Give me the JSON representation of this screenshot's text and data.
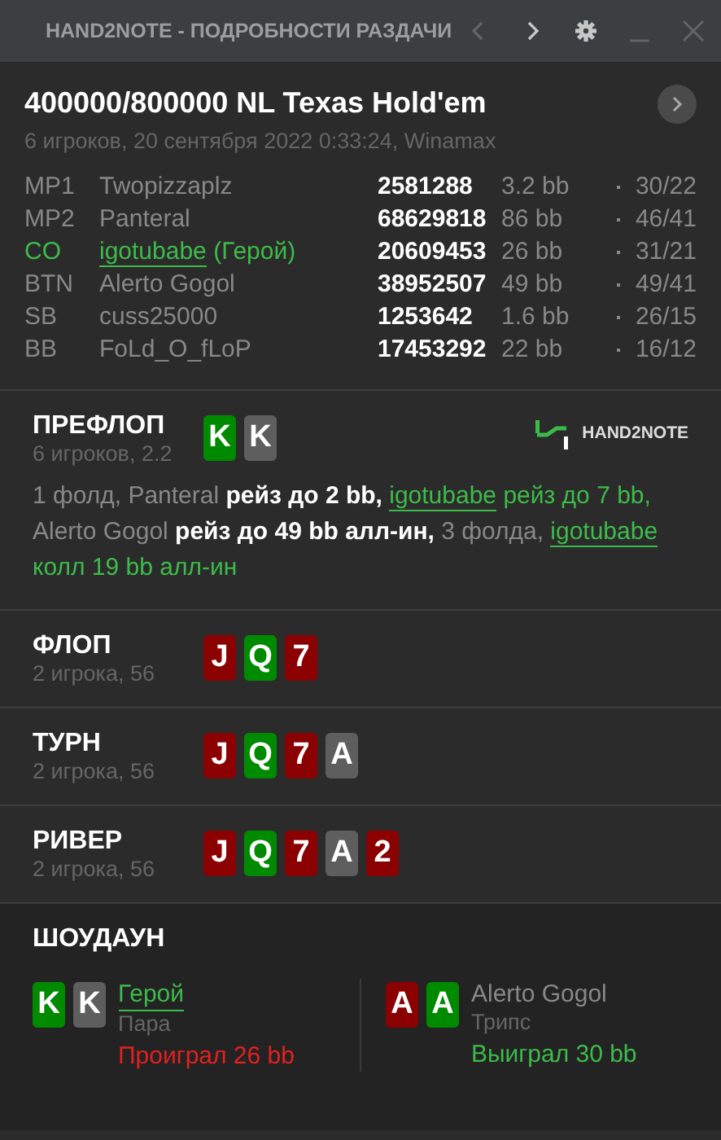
{
  "title_bar": {
    "title": "HAND2NOTE - ПОДРОБНОСТИ РАЗДАЧИ",
    "buttons": [
      {
        "kind": "prev",
        "disabled": true
      },
      {
        "kind": "next",
        "disabled": false
      },
      {
        "kind": "settings",
        "disabled": false
      },
      {
        "kind": "minimize",
        "disabled": true
      },
      {
        "kind": "close",
        "disabled": true
      }
    ]
  },
  "hand": {
    "title": "400000/800000 NL Texas Hold'em",
    "subtitle": "6 игроков, 20 сентября 2022 0:33:24, Winamax",
    "players": [
      {
        "position": "MP1",
        "name": "Twopizzaplz",
        "hero": false,
        "id": "2581288",
        "stack": "3.2 bb",
        "stats": "30/22"
      },
      {
        "position": "MP2",
        "name": "Panteral",
        "hero": false,
        "id": "68629818",
        "stack": "86 bb",
        "stats": "46/41"
      },
      {
        "position": "CO",
        "name": "igotubabe",
        "hero": true,
        "hero_tag": "(Герой)",
        "id": "20609453",
        "stack": "26 bb",
        "stats": "31/21"
      },
      {
        "position": "BTN",
        "name": "Alerto Gogol",
        "hero": false,
        "id": "38952507",
        "stack": "49 bb",
        "stats": "49/41"
      },
      {
        "position": "SB",
        "name": "cuss25000",
        "hero": false,
        "id": "1253642",
        "stack": "1.6 bb",
        "stats": "26/15"
      },
      {
        "position": "BB",
        "name": "FoLd_O_fLoP",
        "hero": false,
        "id": "17453292",
        "stack": "22 bb",
        "stats": "16/12"
      }
    ]
  },
  "streets": [
    {
      "name": "ПРЕФЛОП",
      "info": "6 игроков, 2.2",
      "logo": "HAND2NOTE",
      "cards": [
        {
          "rank": "K",
          "color": "#008a00"
        },
        {
          "rank": "K",
          "color": "#5e5e5e"
        }
      ],
      "actions": [
        {
          "kind": "muted",
          "text": "1 фолд, Panteral "
        },
        {
          "kind": "bold",
          "text": "рейз до 2 bb, "
        },
        {
          "kind": "link",
          "text": "igotubabe"
        },
        {
          "kind": "hero",
          "text": " рейз до 7 bb,"
        },
        {
          "kind": "muted",
          "text": " Alerto Gogol "
        },
        {
          "kind": "bold",
          "text": "рейз до 49 bb алл-ин,"
        },
        {
          "kind": "muted",
          "text": " 3 фолда, "
        },
        {
          "kind": "link",
          "text": "igotubabe"
        },
        {
          "kind": "hero",
          "text": " колл 19 bb алл-ин"
        }
      ]
    },
    {
      "name": "ФЛОП",
      "info": "2 игрока, 56",
      "cards": [
        {
          "rank": "J",
          "color": "#8b0000"
        },
        {
          "rank": "Q",
          "color": "#008a00"
        },
        {
          "rank": "7",
          "color": "#8b0000"
        }
      ]
    },
    {
      "name": "ТУРН",
      "info": "2 игрока, 56",
      "cards": [
        {
          "rank": "J",
          "color": "#8b0000"
        },
        {
          "rank": "Q",
          "color": "#008a00"
        },
        {
          "rank": "7",
          "color": "#8b0000"
        },
        {
          "rank": "A",
          "color": "#5e5e5e"
        }
      ]
    },
    {
      "name": "РИВЕР",
      "info": "2 игрока, 56",
      "cards": [
        {
          "rank": "J",
          "color": "#8b0000"
        },
        {
          "rank": "Q",
          "color": "#008a00"
        },
        {
          "rank": "7",
          "color": "#8b0000"
        },
        {
          "rank": "A",
          "color": "#5e5e5e"
        },
        {
          "rank": "2",
          "color": "#8b0000"
        }
      ]
    }
  ],
  "showdown": {
    "title": "ШОУДАУН",
    "players": [
      {
        "name": "Герой",
        "hero": true,
        "hand": "Пара",
        "result": "Проиграл 26 bb",
        "won": false,
        "cards": [
          {
            "rank": "K",
            "color": "#008a00"
          },
          {
            "rank": "K",
            "color": "#5e5e5e"
          }
        ]
      },
      {
        "name": "Alerto Gogol",
        "hero": false,
        "hand": "Трипс",
        "result": "Выиграл 30 bb",
        "won": true,
        "cards": [
          {
            "rank": "A",
            "color": "#8b0000"
          },
          {
            "rank": "A",
            "color": "#008a00"
          }
        ]
      }
    ]
  }
}
